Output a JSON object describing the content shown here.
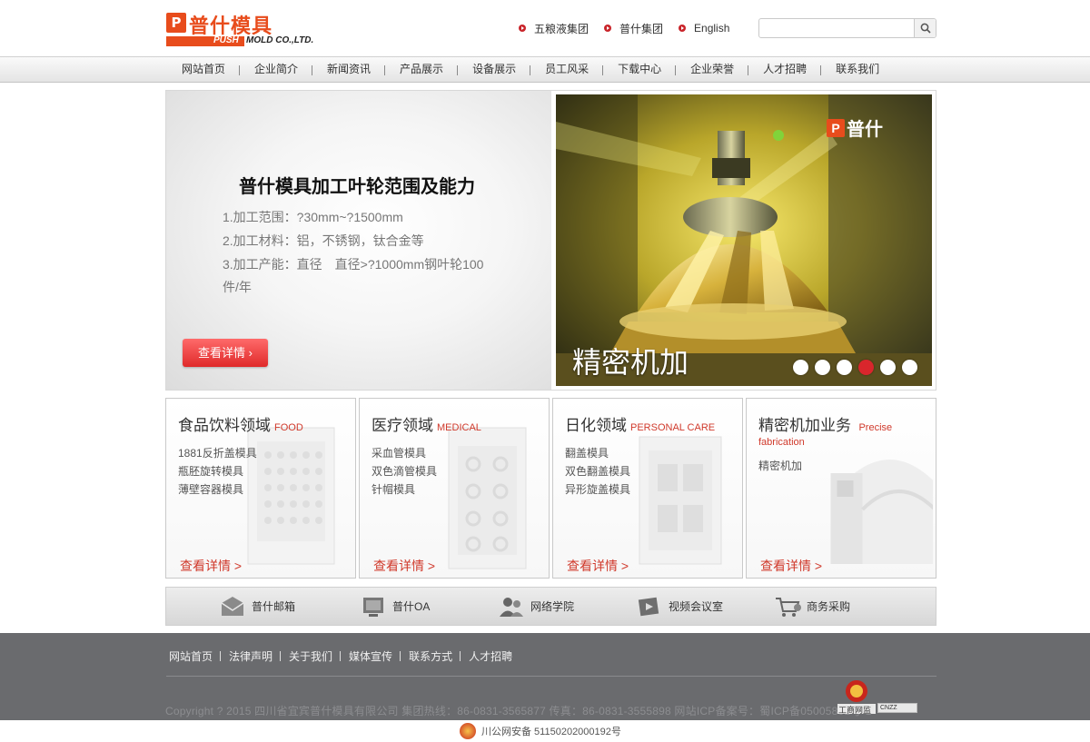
{
  "brand": {
    "logo_mark": "P",
    "name_cn": "普什模具",
    "name_en_push": "PUSH",
    "name_en_rest": "MOLD CO.,LTD."
  },
  "top_links": [
    {
      "label": "五粮液集团"
    },
    {
      "label": "普什集团"
    },
    {
      "label": "English"
    }
  ],
  "search": {
    "placeholder": "",
    "button_icon": "search-icon"
  },
  "nav": [
    {
      "label": "网站首页"
    },
    {
      "label": "企业简介"
    },
    {
      "label": "新闻资讯"
    },
    {
      "label": "产品展示"
    },
    {
      "label": "设备展示"
    },
    {
      "label": "员工风采"
    },
    {
      "label": "下载中心"
    },
    {
      "label": "企业荣誉"
    },
    {
      "label": "人才招聘"
    },
    {
      "label": "联系我们"
    }
  ],
  "banner": {
    "title": "普什模具加工叶轮范围及能力",
    "lines": [
      "1.加工范围：?30mm~?1500mm",
      "2.加工材料：铝，不锈钢，钛合金等",
      "3.加工产能：直径　直径>?1000mm钢叶轮100",
      "件/年"
    ],
    "button": "查看详情 ›",
    "caption": "精密机加",
    "photo_logo_mark": "P",
    "photo_logo_text": "普什",
    "active_slide": 4,
    "slide_count": 6
  },
  "categories": [
    {
      "title_cn": "食品饮料领域",
      "title_en": "FOOD",
      "items": [
        "1881反折盖模具",
        "瓶胚旋转模具",
        "薄壁容器模具"
      ],
      "more": "查看详情 >"
    },
    {
      "title_cn": "医疗领域",
      "title_en": "MEDICAL",
      "items": [
        "采血管模具",
        "双色滴管模具",
        "针帽模具"
      ],
      "more": "查看详情 >"
    },
    {
      "title_cn": "日化领域",
      "title_en": "PERSONAL CARE",
      "items": [
        "翻盖模具",
        "双色翻盖模具",
        "异形旋盖模具"
      ],
      "more": "查看详情 >"
    },
    {
      "title_cn": "精密机加业务",
      "title_en": "Precise",
      "title_en2": "fabrication",
      "items": [
        "精密机加"
      ],
      "more": "查看详情 >"
    }
  ],
  "quick_links": [
    {
      "label": "普什邮箱",
      "icon": "mail-icon"
    },
    {
      "label": "普什OA",
      "icon": "office-icon"
    },
    {
      "label": "网络学院",
      "icon": "people-icon"
    },
    {
      "label": "视频会议室",
      "icon": "video-icon"
    },
    {
      "label": "商务采购",
      "icon": "cart-icon"
    }
  ],
  "footer": {
    "links": [
      {
        "label": "网站首页"
      },
      {
        "label": "法律声明"
      },
      {
        "label": "关于我们"
      },
      {
        "label": "媒体宣传"
      },
      {
        "label": "联系方式"
      },
      {
        "label": "人才招聘"
      }
    ],
    "copyright": "Copyright ? 2015 四川省宜宾普什模具有限公司 集团热线：86-0831-3565877 传真：86-0831-3555898 网站ICP备案号：蜀ICP备05005801号-1",
    "badge_gongshang": "工商网监",
    "badge_cnzz": "CNZZ",
    "police": "川公网安备 51150202000192号"
  },
  "colors": {
    "brand_red": "#e84c1c",
    "accent_red": "#d9262c",
    "footer_bg": "#6a6b6e"
  }
}
